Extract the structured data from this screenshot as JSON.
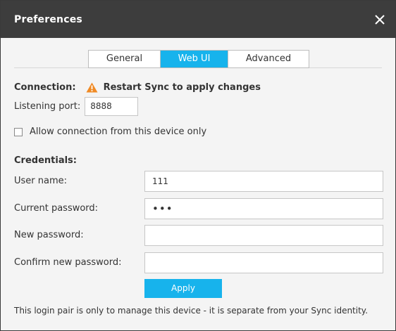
{
  "window": {
    "title": "Preferences"
  },
  "tabs": [
    {
      "label": "General",
      "active": false
    },
    {
      "label": "Web UI",
      "active": true
    },
    {
      "label": "Advanced",
      "active": false
    }
  ],
  "connection": {
    "label": "Connection:",
    "warning_icon": "warning-icon",
    "warning_text": "Restart Sync to apply changes",
    "port_label": "Listening port:",
    "port_value": "8888",
    "allow_local_label": "Allow connection from this device only",
    "allow_local_checked": false
  },
  "credentials": {
    "label": "Credentials:",
    "username_label": "User name:",
    "username_value": "111",
    "current_password_label": "Current password:",
    "current_password_value": "•••",
    "new_password_label": "New password:",
    "new_password_value": "",
    "confirm_password_label": "Confirm new password:",
    "confirm_password_value": ""
  },
  "apply_label": "Apply",
  "footer_note": "This login pair is only to manage this device - it is separate from your Sync identity.",
  "colors": {
    "accent": "#17b3ec",
    "titlebar": "#3d3d3d",
    "warning": "#f08a24"
  }
}
